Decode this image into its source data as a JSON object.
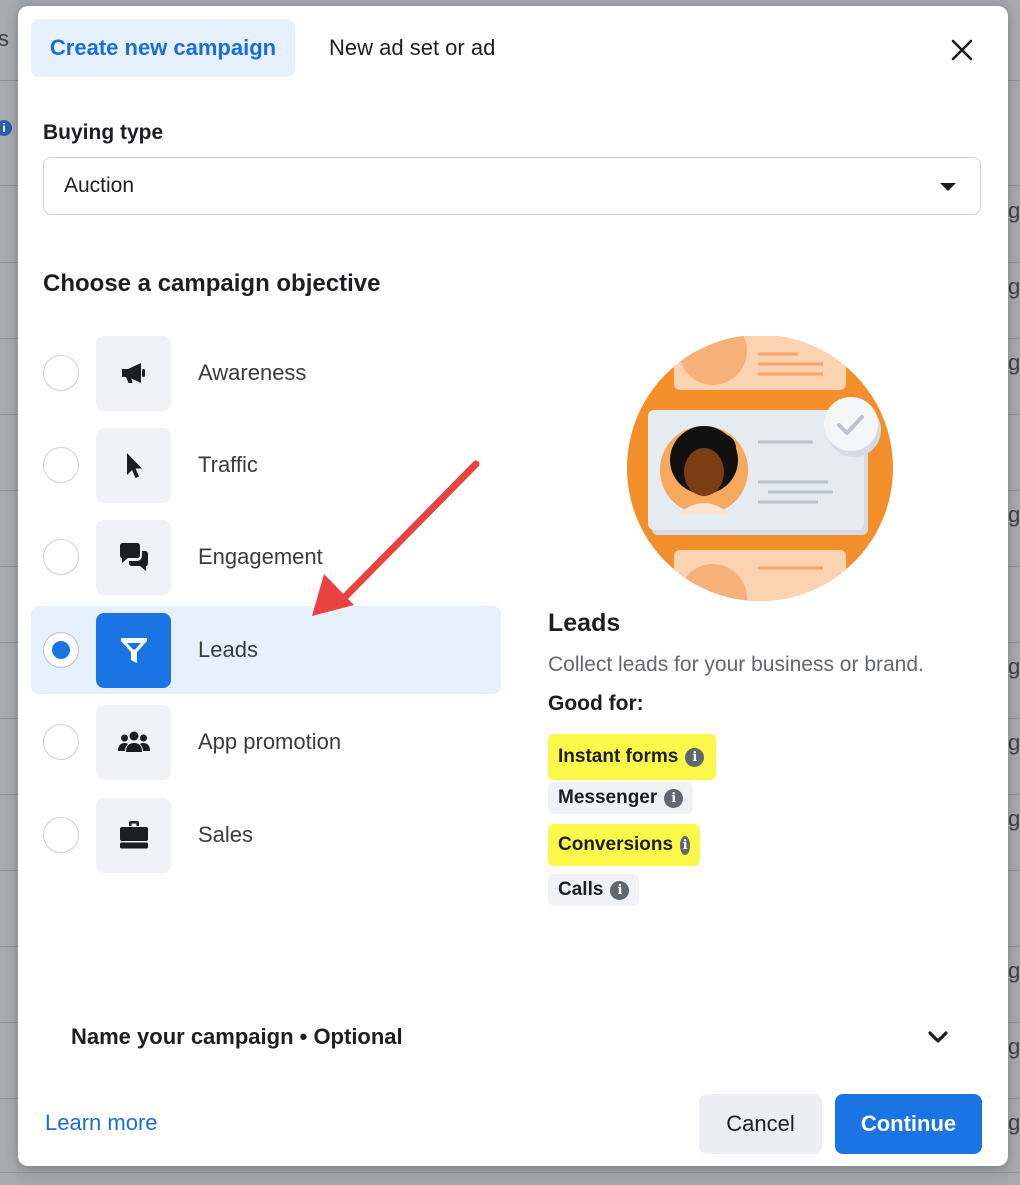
{
  "background": {
    "left_glyph": "s",
    "right_glyph": "g"
  },
  "header": {
    "active_tab": "Create new campaign",
    "other_tab": "New ad set or ad"
  },
  "buying_type": {
    "label": "Buying type",
    "value": "Auction"
  },
  "objective": {
    "title": "Choose a campaign objective",
    "items": [
      {
        "label": "Awareness",
        "icon": "megaphone-icon",
        "selected": false
      },
      {
        "label": "Traffic",
        "icon": "cursor-icon",
        "selected": false
      },
      {
        "label": "Engagement",
        "icon": "chat-bubbles-icon",
        "selected": false
      },
      {
        "label": "Leads",
        "icon": "funnel-icon",
        "selected": true
      },
      {
        "label": "App promotion",
        "icon": "people-icon",
        "selected": false
      },
      {
        "label": "Sales",
        "icon": "briefcase-icon",
        "selected": false
      }
    ]
  },
  "details": {
    "title": "Leads",
    "description": "Collect leads for your business or brand.",
    "good_for_label": "Good for:",
    "good_for": [
      {
        "label": "Instant forms",
        "highlighted": true
      },
      {
        "label": "Messenger",
        "highlighted": false
      },
      {
        "label": "Conversions",
        "highlighted": true
      },
      {
        "label": "Calls",
        "highlighted": false
      }
    ]
  },
  "name_campaign": {
    "label": "Name your campaign • Optional"
  },
  "footer": {
    "learn_more": "Learn more",
    "cancel": "Cancel",
    "continue": "Continue"
  },
  "colors": {
    "accent": "#1b74e4",
    "highlight": "#fbf84a",
    "annotation_arrow": "#e8433f",
    "illustration_orange": "#f28f2a"
  }
}
